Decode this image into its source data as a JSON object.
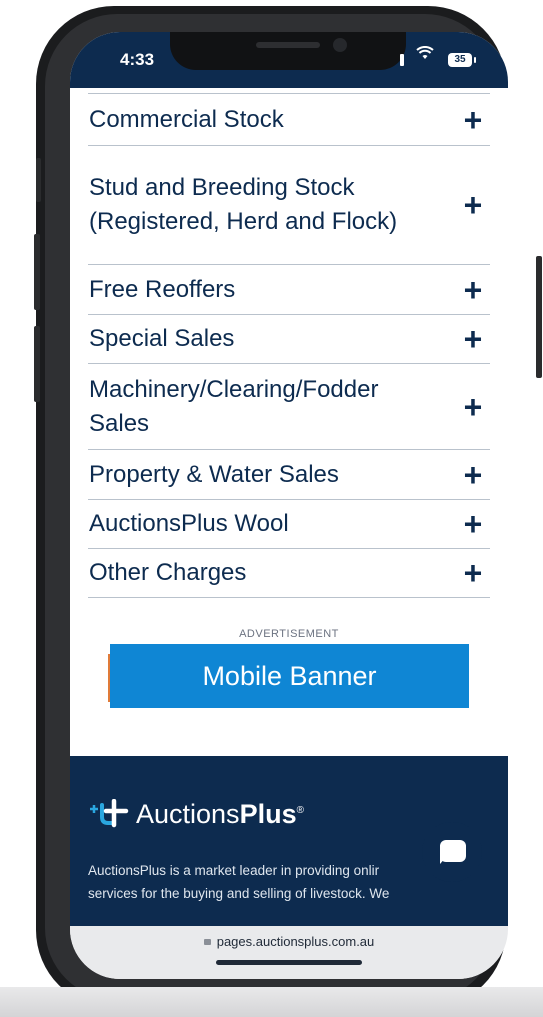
{
  "status": {
    "time": "4:33",
    "battery": "35"
  },
  "accordion": {
    "items": [
      {
        "label": "Commercial Stock"
      },
      {
        "label": "Stud and Breeding Stock (Registered, Herd and Flock)"
      },
      {
        "label": "Free Reoffers"
      },
      {
        "label": "Special Sales"
      },
      {
        "label": "Machinery/Clearing/Fodder Sales"
      },
      {
        "label": "Property & Water Sales"
      },
      {
        "label": "AuctionsPlus Wool"
      },
      {
        "label": "Other Charges"
      }
    ],
    "expand_symbol": "+"
  },
  "ad": {
    "label": "ADVERTISEMENT",
    "banner_text": "Mobile Banner"
  },
  "footer": {
    "brand_prefix": "Auctions",
    "brand_suffix": "Plus",
    "brand_mark": "®",
    "description_line1": "AuctionsPlus is a market leader in providing onlir",
    "description_line2": "services for the buying and selling of livestock. We"
  },
  "browser": {
    "url": "pages.auctionsplus.com.au"
  },
  "colors": {
    "navy": "#0d2b4f",
    "banner_blue": "#0f86d4",
    "logo_accent": "#2aa7e0"
  }
}
